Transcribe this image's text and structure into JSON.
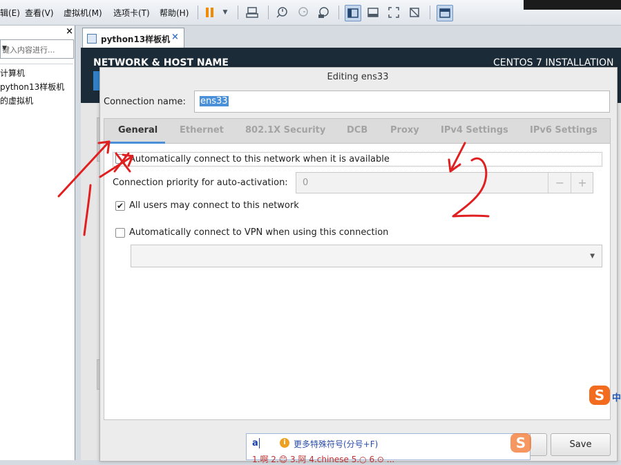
{
  "menubar": {
    "items": [
      "辑(E)",
      "查看(V)",
      "虚拟机(M)",
      "选项卡(T)",
      "帮助(H)"
    ]
  },
  "left_panel": {
    "close_glyph": "×",
    "search_placeholder": "键入内容进行...",
    "tree_items": [
      "计算机",
      "python13样板机",
      "的虚拟机"
    ]
  },
  "vm_tab": {
    "label": "python13样板机",
    "close_glyph": "×"
  },
  "installer": {
    "screen_title": "NETWORK & HOST NAME",
    "product_title": "CENTOS 7 INSTALLATION"
  },
  "dialog": {
    "title": "Editing ens33",
    "connection_name_label": "Connection name:",
    "connection_name_value": "ens33",
    "tabs": [
      "General",
      "Ethernet",
      "802.1X Security",
      "DCB",
      "Proxy",
      "IPv4 Settings",
      "IPv6 Settings"
    ],
    "active_tab": "General",
    "general": {
      "auto_connect_label": "Automatically connect to this network when it is available",
      "auto_connect_checked": false,
      "priority_label": "Connection priority for auto-activation:",
      "priority_value": "0",
      "minus_glyph": "−",
      "plus_glyph": "+",
      "all_users_label": "All users may connect to this network",
      "all_users_checked": true,
      "vpn_label": "Automatically connect to VPN when using this connection",
      "vpn_checked": false,
      "check_glyph": "✔"
    },
    "save_label": "Save"
  },
  "ime": {
    "typed": "a",
    "info_glyph": "i",
    "hint": "更多特殊符号(分号+F)",
    "candidates": "1.啊  2.😊  3.阿  4.chinese  5.○  6.⊙ ..."
  },
  "sogou": {
    "logo_glyph": "S",
    "zh_label": "中"
  },
  "colors": {
    "header_bg": "#1c2b38",
    "accent_blue": "#4a90d9",
    "annotation_red": "#e02020"
  }
}
